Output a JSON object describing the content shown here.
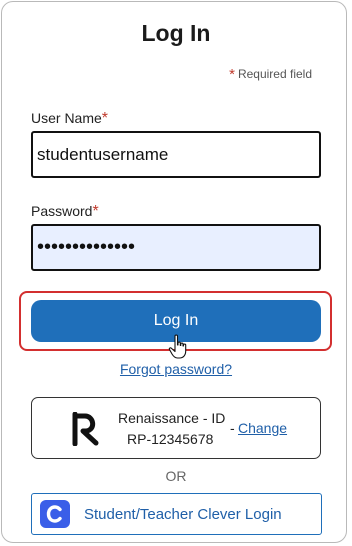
{
  "form": {
    "title": "Log In",
    "required_note": "Required field",
    "required_mark": "*"
  },
  "username": {
    "label": "User Name",
    "value": "studentusername"
  },
  "password": {
    "label": "Password",
    "value": "••••••••••••••"
  },
  "actions": {
    "login_label": "Log In",
    "forgot_label": "Forgot password?"
  },
  "renaissance": {
    "name": "Renaissance - ID",
    "id": "RP-12345678",
    "separator": "-",
    "change_label": "Change"
  },
  "divider": {
    "or_label": "OR"
  },
  "clever": {
    "label": "Student/Teacher Clever Login",
    "logo_letter": "C",
    "accent": "#3a5ee8"
  },
  "colors": {
    "primary": "#1f6fba",
    "link": "#1f5fa8",
    "required": "#c0392b",
    "focus_ring": "#d32f2f",
    "password_fill": "#e8efff"
  },
  "icons": {
    "cursor": "hand-pointer-icon",
    "renaissance_logo": "renaissance-logo-icon",
    "clever_logo": "clever-logo-icon"
  }
}
